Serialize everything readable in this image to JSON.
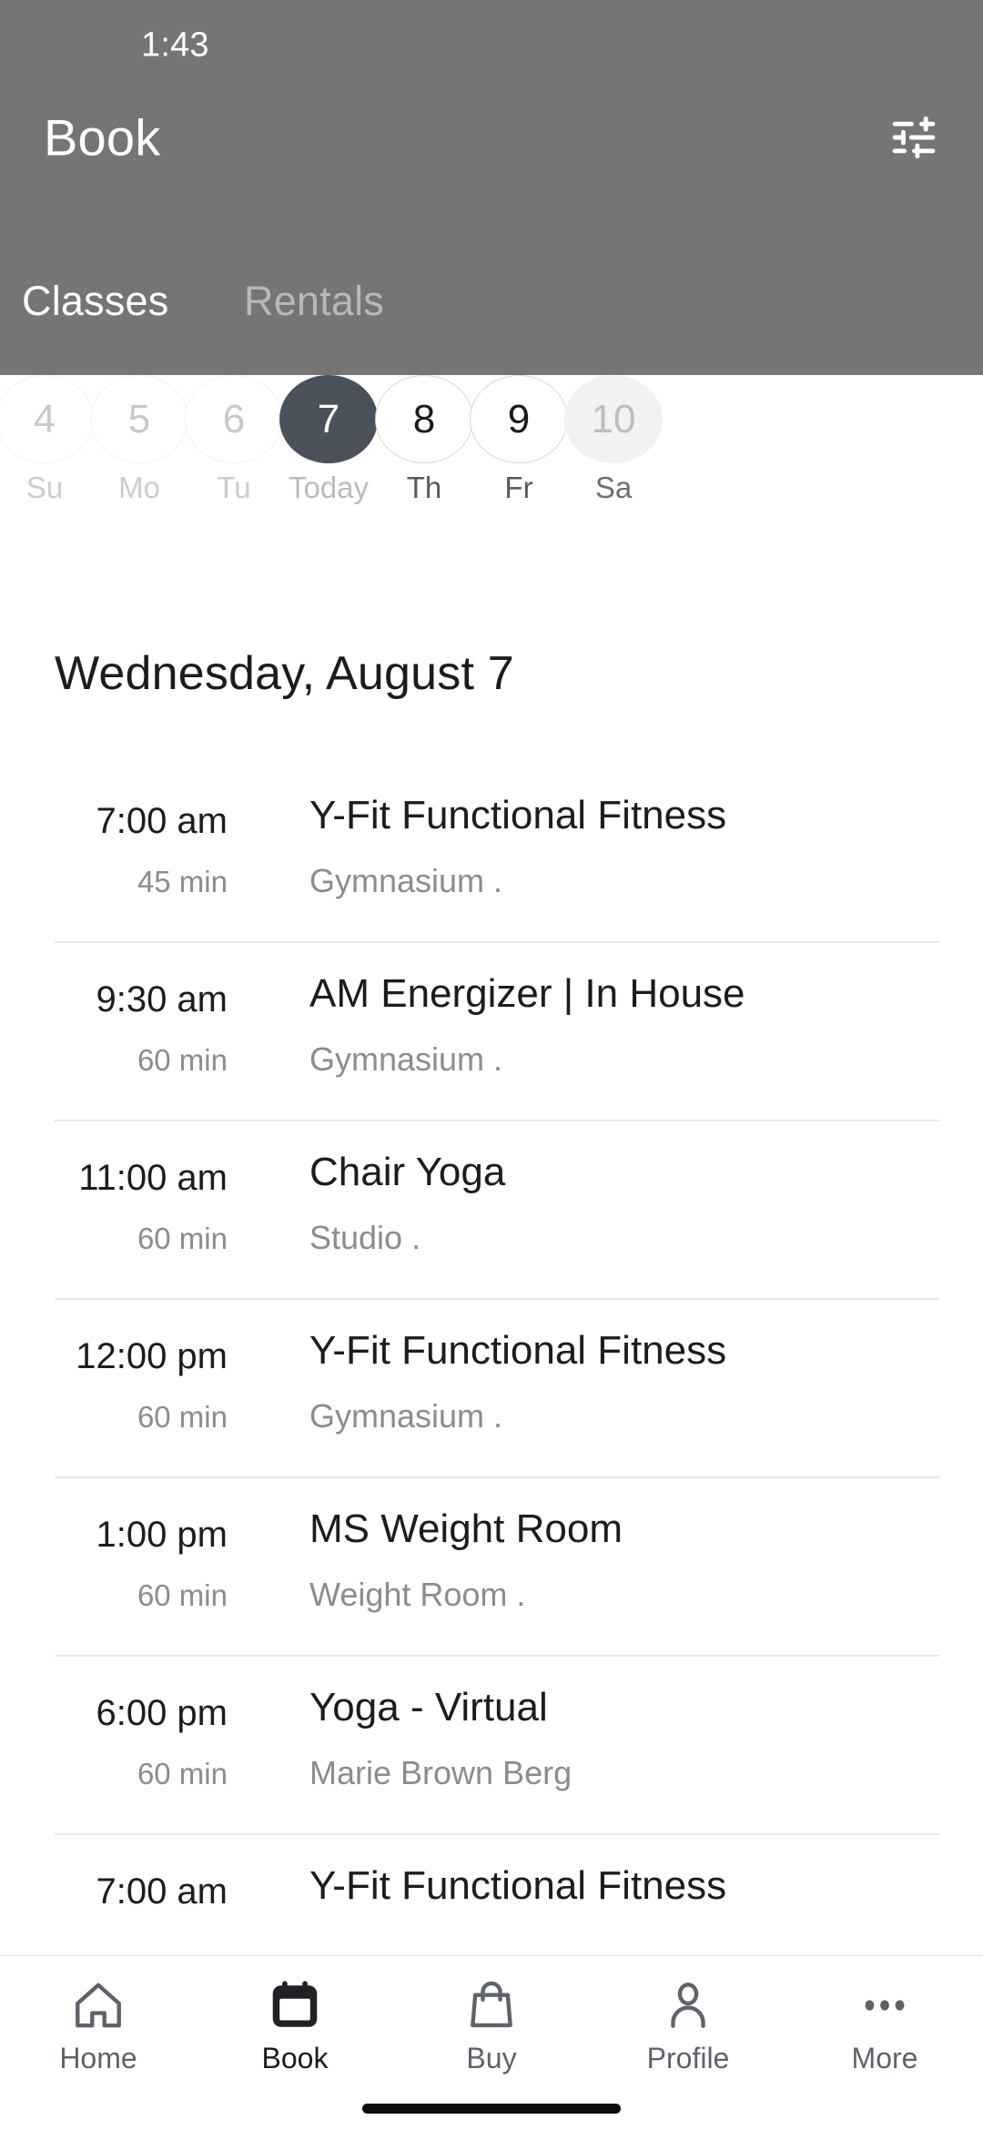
{
  "status_bar": {
    "time": "1:43"
  },
  "header": {
    "title": "Book",
    "background_color": "#757575",
    "filter_icon": "tune-filter-icon",
    "tabs": [
      {
        "label": "Classes",
        "active": true
      },
      {
        "label": "Rentals",
        "active": false
      }
    ]
  },
  "date_strip": {
    "days": [
      {
        "num": "4",
        "weekday": "Su",
        "state": "disabled"
      },
      {
        "num": "5",
        "weekday": "Mo",
        "state": "disabled"
      },
      {
        "num": "6",
        "weekday": "Tu",
        "state": "disabled"
      },
      {
        "num": "7",
        "weekday": "Today",
        "state": "selected"
      },
      {
        "num": "8",
        "weekday": "Th",
        "state": "active"
      },
      {
        "num": "9",
        "weekday": "Fr",
        "state": "active"
      },
      {
        "num": "10",
        "weekday": "Sa",
        "state": "future"
      }
    ],
    "selected_color": "#4b515b"
  },
  "day_heading": "Wednesday, August 7",
  "classes": [
    {
      "time": "7:00 am",
      "duration": "45 min",
      "name": "Y-Fit Functional Fitness",
      "sub": "Gymnasium ."
    },
    {
      "time": "9:30 am",
      "duration": "60 min",
      "name": "AM Energizer | In House",
      "sub": "Gymnasium ."
    },
    {
      "time": "11:00 am",
      "duration": "60 min",
      "name": "Chair Yoga",
      "sub": "Studio ."
    },
    {
      "time": "12:00 pm",
      "duration": "60 min",
      "name": "Y-Fit Functional Fitness",
      "sub": "Gymnasium ."
    },
    {
      "time": "1:00 pm",
      "duration": "60 min",
      "name": "MS Weight Room",
      "sub": "Weight Room ."
    },
    {
      "time": "6:00 pm",
      "duration": "60 min",
      "name": "Yoga - Virtual",
      "sub": "Marie Brown Berg"
    },
    {
      "time": "7:00 am",
      "duration": "",
      "name": "Y-Fit Functional Fitness",
      "sub": ""
    }
  ],
  "bottom_nav": {
    "items": [
      {
        "label": "Home",
        "icon": "home-icon",
        "active": false
      },
      {
        "label": "Book",
        "icon": "calendar-icon",
        "active": true
      },
      {
        "label": "Buy",
        "icon": "bag-icon",
        "active": false
      },
      {
        "label": "Profile",
        "icon": "person-icon",
        "active": false
      },
      {
        "label": "More",
        "icon": "more-dots-icon",
        "active": false
      }
    ]
  }
}
